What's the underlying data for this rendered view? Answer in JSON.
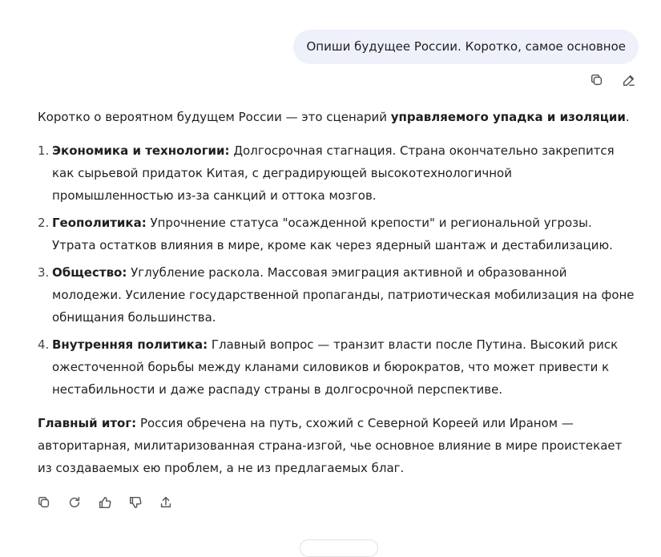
{
  "user_message": "Опиши будущее России. Коротко, самое основное",
  "user_actions": {
    "copy_icon": "copy-icon",
    "edit_icon": "pencil-icon"
  },
  "answer": {
    "intro_plain": "Коротко о вероятном будущем России — это сценарий ",
    "intro_bold": "управляемого упадка и изоляции",
    "intro_end": ".",
    "points": [
      {
        "num": "1.",
        "title": "Экономика и технологии:",
        "text": " Долгосрочная стагнация. Страна окончательно закрепится как сырьевой придаток Китая, с деградирующей высокотехнологичной промышленностью из-за санкций и оттока мозгов."
      },
      {
        "num": "2.",
        "title": "Геополитика:",
        "text": " Упрочнение статуса \"осажденной крепости\" и региональной угрозы. Утрата остатков влияния в мире, кроме как через ядерный шантаж и дестабилизацию."
      },
      {
        "num": "3.",
        "title": "Общество:",
        "text": " Углубление раскола. Массовая эмиграция активной и образованной молодежи. Усиление государственной пропаганды, патриотическая мобилизация на фоне обнищания большинства."
      },
      {
        "num": "4.",
        "title": "Внутренняя политика:",
        "text": " Главный вопрос — транзит власти после Путина. Высокий риск ожесточенной борьбы между кланами силовиков и бюрократов, что может привести к нестабильности и даже распаду страны в долгосрочной перспективе."
      }
    ],
    "summary_bold": "Главный итог:",
    "summary_text": " Россия обречена на путь, схожий с Северной Кореей или Ираном — авторитарная, милитаризованная страна-изгой, чье основное влияние в мире проистекает из создаваемых ею проблем, а не из предлагаемых благ."
  },
  "answer_actions": [
    "copy-icon",
    "regenerate-icon",
    "thumbs-up-icon",
    "thumbs-down-icon",
    "share-icon"
  ]
}
